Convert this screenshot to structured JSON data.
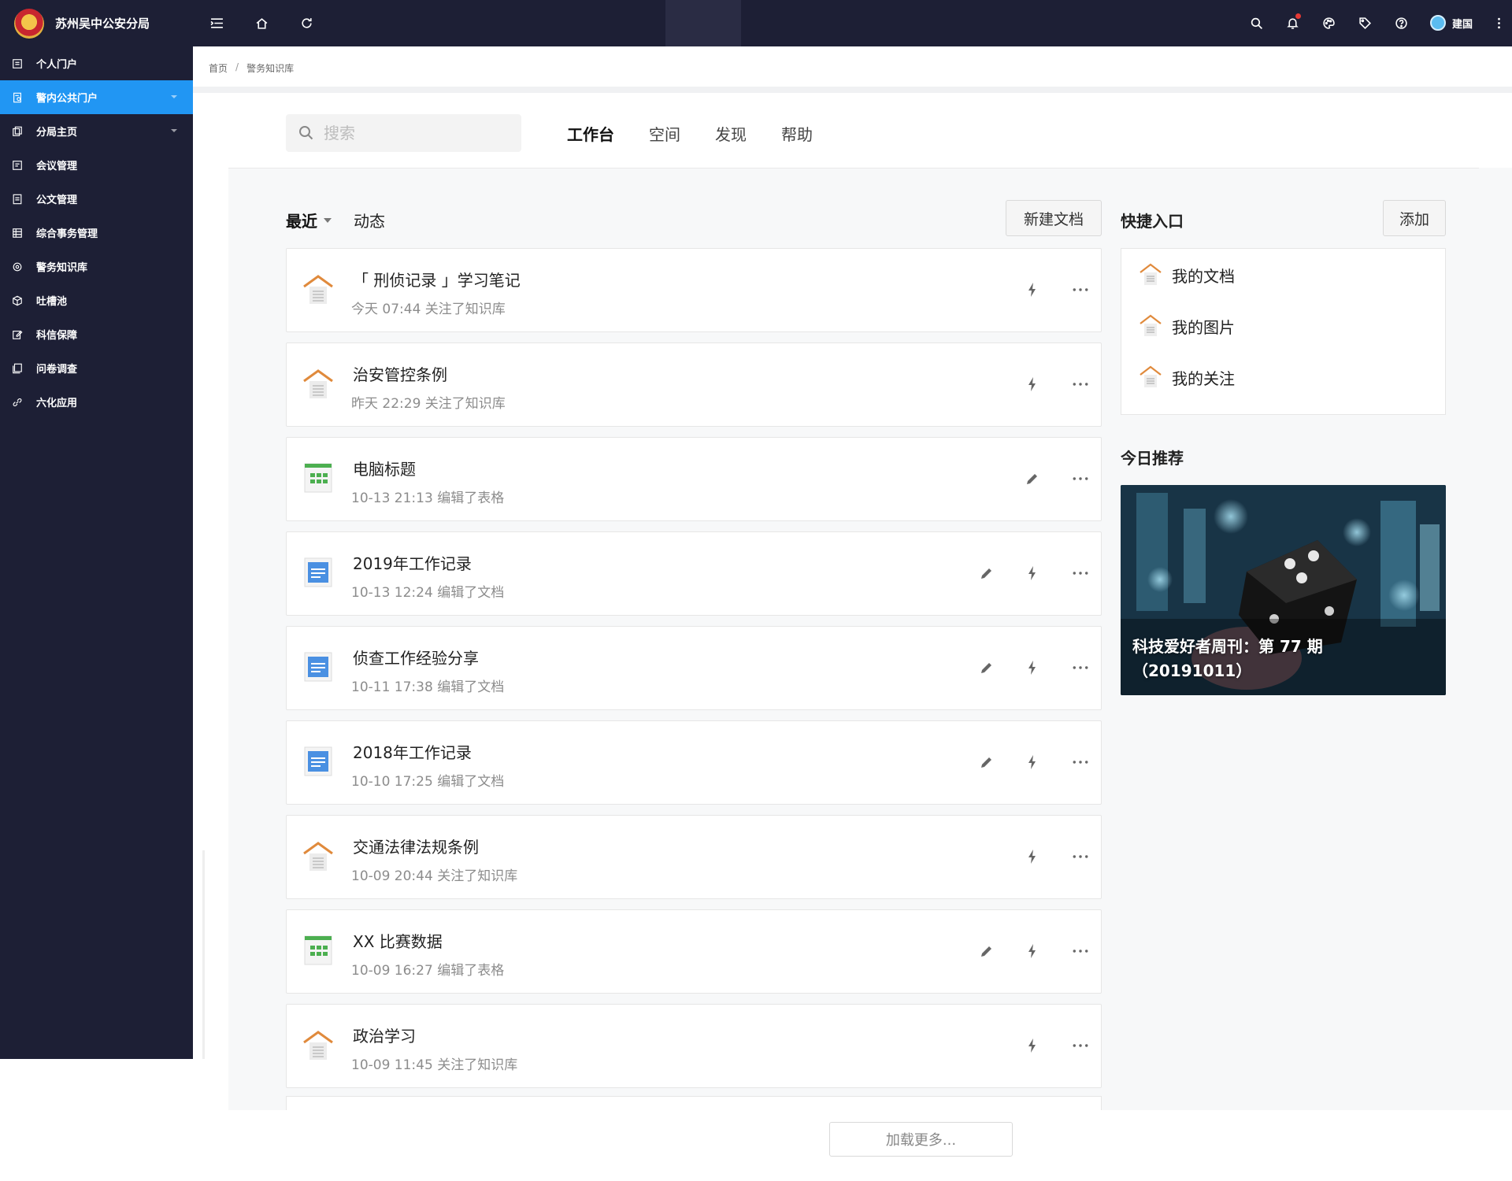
{
  "app": {
    "org_name": "苏州吴中公安分局"
  },
  "sidebar": {
    "items": [
      {
        "label": "个人门户",
        "icon": "portal-icon",
        "active": false
      },
      {
        "label": "警内公共门户",
        "icon": "public-portal-icon",
        "active": true,
        "expandable": true
      },
      {
        "label": "分局主页",
        "icon": "home-page-icon",
        "active": false,
        "expandable": true
      },
      {
        "label": "会议管理",
        "icon": "meeting-icon",
        "active": false
      },
      {
        "label": "公文管理",
        "icon": "document-icon",
        "active": false
      },
      {
        "label": "综合事务管理",
        "icon": "affairs-icon",
        "active": false
      },
      {
        "label": "警务知识库",
        "icon": "knowledge-icon",
        "active": false
      },
      {
        "label": "吐槽池",
        "icon": "box-icon",
        "active": false
      },
      {
        "label": "科信保障",
        "icon": "edit-icon",
        "active": false
      },
      {
        "label": "问卷调查",
        "icon": "survey-icon",
        "active": false
      },
      {
        "label": "六化应用",
        "icon": "link-icon",
        "active": false
      }
    ]
  },
  "topbar": {
    "user_name": "建国"
  },
  "breadcrumb": {
    "home": "首页",
    "separator": "/",
    "current": "警务知识库"
  },
  "search": {
    "placeholder": "搜索"
  },
  "tabs": [
    {
      "label": "工作台",
      "active": true
    },
    {
      "label": "空间",
      "active": false
    },
    {
      "label": "发现",
      "active": false
    },
    {
      "label": "帮助",
      "active": false
    }
  ],
  "list": {
    "recent_label": "最近",
    "activity_label": "动态",
    "new_doc_label": "新建文档",
    "load_more_label": "加载更多...",
    "items": [
      {
        "title": "「 刑侦记录 」学习笔记",
        "meta": "今天 07:44 关注了知识库",
        "type": "library",
        "editable": false
      },
      {
        "title": "治安管控条例",
        "meta": "昨天 22:29 关注了知识库",
        "type": "library",
        "editable": false
      },
      {
        "title": "电脑标题",
        "meta": "10-13 21:13 编辑了表格",
        "type": "sheet",
        "editable": true,
        "flash": false
      },
      {
        "title": "2019年工作记录",
        "meta": "10-13 12:24 编辑了文档",
        "type": "doc",
        "editable": true
      },
      {
        "title": "侦查工作经验分享",
        "meta": "10-11 17:38 编辑了文档",
        "type": "doc",
        "editable": true
      },
      {
        "title": "2018年工作记录",
        "meta": "10-10 17:25 编辑了文档",
        "type": "doc",
        "editable": true
      },
      {
        "title": "交通法律法规条例",
        "meta": "10-09 20:44 关注了知识库",
        "type": "library",
        "editable": false
      },
      {
        "title": "XX 比赛数据",
        "meta": "10-09 16:27 编辑了表格",
        "type": "sheet",
        "editable": true
      },
      {
        "title": "政治学习",
        "meta": "10-09 11:45 关注了知识库",
        "type": "library",
        "editable": false
      }
    ]
  },
  "quick": {
    "title": "快捷入口",
    "add_label": "添加",
    "items": [
      "我的文档",
      "我的图片",
      "我的关注"
    ]
  },
  "recommend": {
    "title": "今日推荐",
    "caption_line1": "科技爱好者周刊：第 77 期",
    "caption_line2": "（20191011）"
  },
  "colors": {
    "sidebar_bg": "#1d1f35",
    "accent": "#2196f3",
    "library_orange": "#e08a3c",
    "sheet_green": "#4caf50",
    "doc_blue": "#4a90e2"
  }
}
